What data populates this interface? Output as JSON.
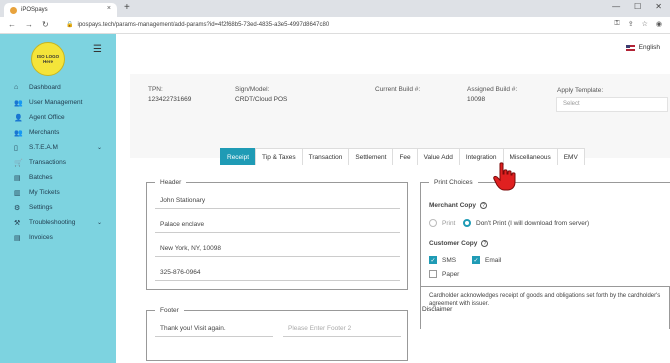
{
  "browser": {
    "tab_title": "iPOSpays",
    "tab_close": "×",
    "new_tab": "+",
    "url": "ipospays.tech/params-management/add-params?id=4f2f68b5-73ed-4835-a3e5-4997d8647c80",
    "win_min": "—",
    "win_max": "☐",
    "win_close": "✕"
  },
  "sidebar": {
    "logo_text": "ISO LOGO Here",
    "items": [
      {
        "label": "Dashboard",
        "icon": "home-icon",
        "glyph": "⌂"
      },
      {
        "label": "User Management",
        "icon": "users-icon",
        "glyph": "👥"
      },
      {
        "label": "Agent Office",
        "icon": "agent-icon",
        "glyph": "👤"
      },
      {
        "label": "Merchants",
        "icon": "merchants-icon",
        "glyph": "👥"
      },
      {
        "label": "S.T.E.A.M",
        "icon": "device-icon",
        "glyph": "▯",
        "chevron": "⌄"
      },
      {
        "label": "Transactions",
        "icon": "cart-icon",
        "glyph": "🛒"
      },
      {
        "label": "Batches",
        "icon": "batch-icon",
        "glyph": "▤"
      },
      {
        "label": "My Tickets",
        "icon": "ticket-icon",
        "glyph": "▥"
      },
      {
        "label": "Settings",
        "icon": "gear-icon",
        "glyph": "⚙"
      },
      {
        "label": "Troubleshooting",
        "icon": "tools-icon",
        "glyph": "⚒",
        "chevron": "⌄"
      },
      {
        "label": "Invoices",
        "icon": "invoice-icon",
        "glyph": "▤"
      }
    ]
  },
  "header": {
    "language": "English"
  },
  "info": {
    "tpn_label": "TPN:",
    "tpn_value": "123422731669",
    "model_label": "Sign/Model:",
    "model_value": "CRDT/Cloud POS",
    "current_build_label": "Current Build #:",
    "assigned_build_label": "Assigned Build #:",
    "assigned_build_value": "10098",
    "template_label": "Apply Template:",
    "template_placeholder": "Select"
  },
  "tabs": [
    "Receipt",
    "Tip & Taxes",
    "Transaction",
    "Settlement",
    "Fee",
    "Value Add",
    "Integration",
    "Miscellaneous",
    "EMV"
  ],
  "header_box": {
    "legend": "Header",
    "lines": [
      "John Stationary",
      "Palace enclave",
      "New York, NY, 10098",
      "325-876-0964"
    ]
  },
  "footer_box": {
    "legend": "Footer",
    "line1": "Thank you! Visit again.",
    "line2_placeholder": "Please Enter Footer 2"
  },
  "print_choices": {
    "legend": "Print Choices",
    "merchant_copy_title": "Merchant Copy",
    "opt_print": "Print",
    "opt_dont_print": "Don't Print (I will download from server)",
    "customer_copy_title": "Customer Copy",
    "opt_sms": "SMS",
    "opt_email": "Email",
    "opt_paper": "Paper",
    "help": "?"
  },
  "disclaimer": {
    "title": "Disclaimer",
    "text": "Cardholder acknowledges receipt of goods and obligations set forth by the cardholder's agreement with issuer."
  },
  "colors": {
    "sidebar": "#7dd3e0",
    "accent": "#1f9bb5",
    "logo": "#f4e43a",
    "cursor": "#e02020"
  }
}
